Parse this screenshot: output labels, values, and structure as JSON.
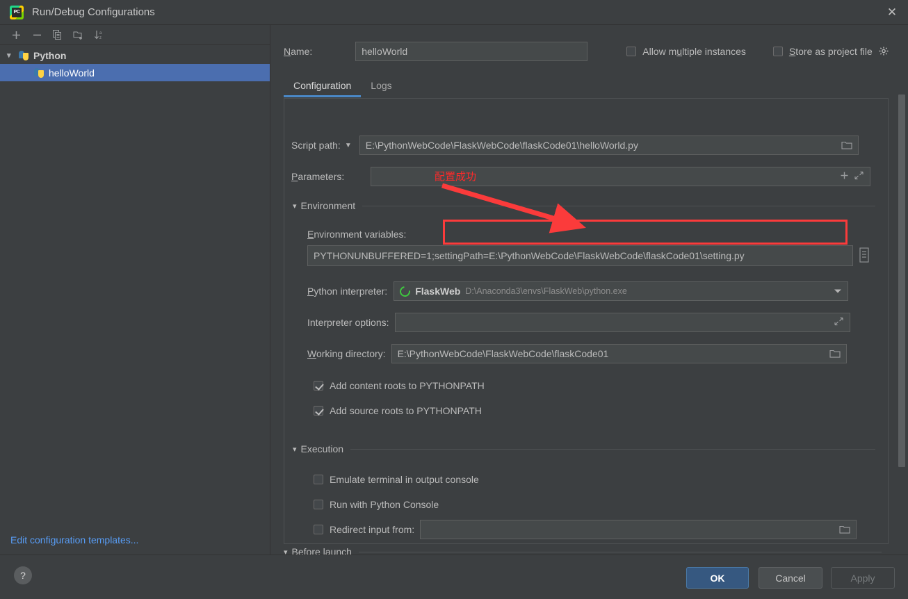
{
  "window": {
    "title": "Run/Debug Configurations",
    "app_icon": "pycharm-icon",
    "app_icon_text": "PC",
    "close_icon": "close-icon"
  },
  "sidebar": {
    "toolbar": [
      {
        "name": "add-configuration-button",
        "icon": "plus-icon"
      },
      {
        "name": "remove-configuration-button",
        "icon": "minus-icon"
      },
      {
        "name": "copy-configuration-button",
        "icon": "copy-icon"
      },
      {
        "name": "new-folder-button",
        "icon": "folder-add-icon"
      },
      {
        "name": "sort-configurations-button",
        "icon": "sort-az-icon"
      }
    ],
    "tree": [
      {
        "label": "Python",
        "type": "group",
        "expanded": true,
        "icon": "python-icon"
      },
      {
        "label": "helloWorld",
        "type": "child",
        "selected": true,
        "icon": "python-icon"
      }
    ],
    "edit_templates_link": "Edit configuration templates..."
  },
  "header": {
    "name_label": "Name:",
    "name_mnemonic": "N",
    "name_value": "helloWorld",
    "allow_multiple_instances": {
      "label": "Allow multiple instances",
      "checked": false
    },
    "store_as_project_file": {
      "label": "Store as project file",
      "checked": false
    },
    "gear_icon": "gear-icon"
  },
  "tabs": [
    {
      "label": "Configuration",
      "active": true
    },
    {
      "label": "Logs",
      "active": false
    }
  ],
  "form": {
    "script_path": {
      "label": "Script path:",
      "value": "E:\\PythonWebCode\\FlaskWebCode\\flaskCode01\\helloWorld.py",
      "browse_icon": "folder-browse-icon",
      "dropdown_icon": "chevron-down-icon"
    },
    "parameters": {
      "label": "Parameters:",
      "value": "",
      "add_icon": "plus-icon",
      "expand_icon": "expand-icon"
    },
    "environment_section": {
      "title": "Environment",
      "expanded": true
    },
    "environment_variables": {
      "label": "Environment variables:",
      "value_prefix": "PYTHONUNBUFFERED=1",
      "value_highlight": ";settingPath=E:\\PythonWebCode\\FlaskWebCode\\flaskCode01\\setting.py",
      "full_value": "PYTHONUNBUFFERED=1;settingPath=E:\\PythonWebCode\\FlaskWebCode\\flaskCode01\\setting.py",
      "editor_icon": "list-editor-icon"
    },
    "python_interpreter": {
      "label": "Python interpreter:",
      "env_icon": "anaconda-icon",
      "name": "FlaskWeb",
      "path": "D:\\Anaconda3\\envs\\FlaskWeb\\python.exe",
      "dropdown_icon": "chevron-down-icon"
    },
    "interpreter_options": {
      "label": "Interpreter options:",
      "value": "",
      "expand_icon": "expand-icon"
    },
    "working_directory": {
      "label": "Working directory:",
      "value": "E:\\PythonWebCode\\FlaskWebCode\\flaskCode01",
      "browse_icon": "folder-browse-icon"
    },
    "add_content_roots": {
      "label": "Add content roots to PYTHONPATH",
      "checked": true
    },
    "add_source_roots": {
      "label": "Add source roots to PYTHONPATH",
      "checked": true
    },
    "execution_section": {
      "title": "Execution",
      "expanded": true
    },
    "emulate_terminal": {
      "label": "Emulate terminal in output console",
      "checked": false
    },
    "run_with_python_console": {
      "label": "Run with Python Console",
      "checked": false
    },
    "redirect_input": {
      "label": "Redirect input from:",
      "checked": false,
      "value": "",
      "browse_icon": "folder-browse-icon"
    },
    "before_launch_section": {
      "title": "Before launch",
      "expanded": true
    }
  },
  "annotation": {
    "text": "配置成功",
    "color": "#ff2a2a",
    "arrow_icon": "red-arrow-icon",
    "highlight_box_color": "#fb3b3b"
  },
  "footer": {
    "help_label": "?",
    "ok_label": "OK",
    "cancel_label": "Cancel",
    "apply_label": "Apply",
    "apply_disabled": true
  },
  "colors": {
    "background": "#3c3f41",
    "field_background": "#45494a",
    "selection_blue": "#4b6eaf",
    "accent_link": "#589df6",
    "tab_underline": "#4a88c7",
    "primary_button": "#365880",
    "annotation_red": "#ff2a2a"
  }
}
